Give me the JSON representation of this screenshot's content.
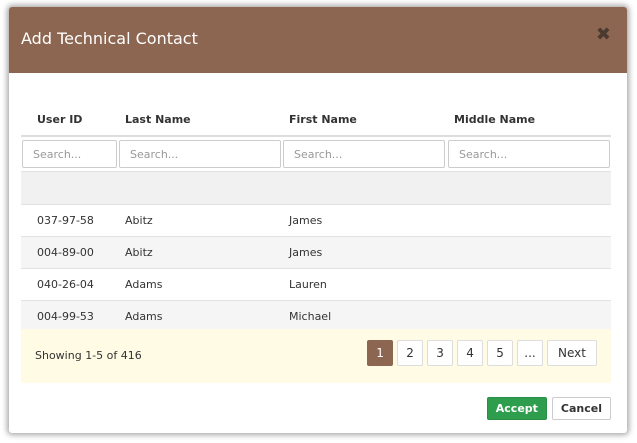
{
  "modal": {
    "title": "Add Technical Contact",
    "close_symbol": "✖"
  },
  "grid": {
    "columns": [
      "User ID",
      "Last Name",
      "First Name",
      "Middle Name"
    ],
    "filter_placeholder": "Search...",
    "rows": [
      [
        "037-97-58",
        "Abitz",
        "James",
        ""
      ],
      [
        "004-89-00",
        "Abitz",
        "James",
        ""
      ],
      [
        "040-26-04",
        "Adams",
        "Lauren",
        ""
      ],
      [
        "004-99-53",
        "Adams",
        "Michael",
        ""
      ]
    ]
  },
  "pager": {
    "summary": "Showing 1-5 of 416",
    "pages": [
      "1",
      "2",
      "3",
      "4",
      "5",
      "..."
    ],
    "next": "Next"
  },
  "actions": {
    "accept": "Accept",
    "cancel": "Cancel"
  },
  "colors": {
    "header": "#8c6650",
    "accept": "#2e9e4e",
    "footer": "#fffbe5"
  }
}
